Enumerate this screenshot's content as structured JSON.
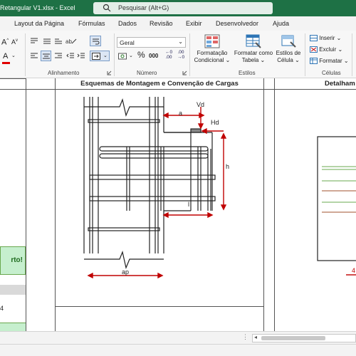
{
  "title_bar": {
    "document": "Retangular V1.xlsx  -  Excel",
    "search_placeholder": "Pesquisar (Alt+G)"
  },
  "menu_tabs": [
    "Layout da Página",
    "Fórmulas",
    "Dados",
    "Revisão",
    "Exibir",
    "Desenvolvedor",
    "Ajuda"
  ],
  "ribbon": {
    "font_size_up": "A",
    "font_size_down": "A",
    "font_color": "A",
    "alignment_label": "Alinhamento",
    "number_format": "Geral",
    "percent": "%",
    "thousands": "000",
    "dec_inc": "←0 .00",
    "dec_dec": ".00 →0",
    "number_label": "Número",
    "cond_format": [
      "Formatação",
      "Condicional ⌄"
    ],
    "format_table": [
      "Formatar como",
      "Tabela ⌄"
    ],
    "cell_styles": [
      "Estilos de",
      "Célula ⌄"
    ],
    "styles_label": "Estilos",
    "insert": "Inserir ⌄",
    "delete": "Excluir ⌄",
    "format": "Formatar ⌄",
    "cells_label": "Células"
  },
  "sheet": {
    "header_main": "Esquemas de Montagem e Convenção de Cargas",
    "header_right": "Detalham",
    "left_cell": "rto!",
    "left_digit": "4",
    "right_digit": "4",
    "diagram": {
      "labels": [
        "a",
        "Vd",
        "Hd",
        "h",
        "l",
        "ap"
      ]
    }
  },
  "colors": {
    "excel_green": "#1e7145",
    "dimension_red": "#c00000",
    "success_fill": "#c6efce"
  }
}
